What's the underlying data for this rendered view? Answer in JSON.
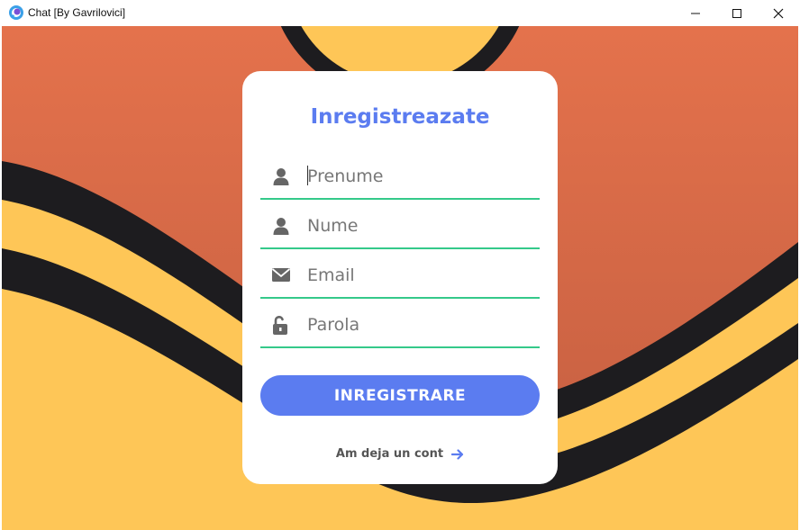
{
  "window": {
    "title": "Chat [By Gavrilovici]"
  },
  "form": {
    "title": "Inregistreazate",
    "fields": [
      {
        "icon": "user-icon",
        "placeholder": "Prenume",
        "value": ""
      },
      {
        "icon": "user-icon",
        "placeholder": "Nume",
        "value": ""
      },
      {
        "icon": "envelope-icon",
        "placeholder": "Email",
        "value": ""
      },
      {
        "icon": "unlock-icon",
        "placeholder": "Parola",
        "value": ""
      }
    ],
    "submit_label": "INREGISTRARE",
    "login_link": "Am deja un cont"
  },
  "colors": {
    "accent": "#5b7cf0",
    "underline": "#34c98a",
    "orange_top": "#e4724c",
    "orange_bottom": "#c25d40",
    "yellow": "#fec657",
    "stripe": "#1d1c1f"
  }
}
